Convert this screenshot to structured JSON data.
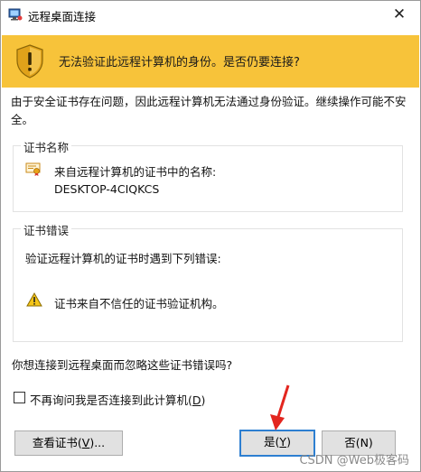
{
  "window": {
    "title": "远程桌面连接",
    "close_symbol": "✕"
  },
  "warning": {
    "text": "无法验证此远程计算机的身份。是否仍要连接?",
    "color": "#f7c33a"
  },
  "description": "由于安全证书存在问题，因此远程计算机无法通过身份验证。继续操作可能不安全。",
  "cert_name_group": {
    "legend": "证书名称",
    "line1": "来自远程计算机的证书中的名称:",
    "line2": "DESKTOP-4CIQKCS"
  },
  "cert_error_group": {
    "legend": "证书错误",
    "intro": "验证远程计算机的证书时遇到下列错误:",
    "item": "证书来自不信任的证书验证机构。"
  },
  "question": "你想连接到远程桌面而忽略这些证书错误吗?",
  "checkbox": {
    "label_pre": "不再询问我是否连接到此计算机(",
    "label_key": "D",
    "label_post": ")",
    "checked": false
  },
  "buttons": {
    "view_pre": "查看证书(",
    "view_key": "V",
    "view_post": ")...",
    "yes_pre": "是(",
    "yes_key": "Y",
    "yes_post": ")",
    "no_label": "否(N)"
  },
  "watermark": "CSDN @Web极客码",
  "icons": {
    "title": "remote-desktop-icon",
    "shield": "warning-shield-icon",
    "cert": "certificate-icon",
    "error": "warning-triangle-icon",
    "arrow": "red-arrow-annotation"
  }
}
